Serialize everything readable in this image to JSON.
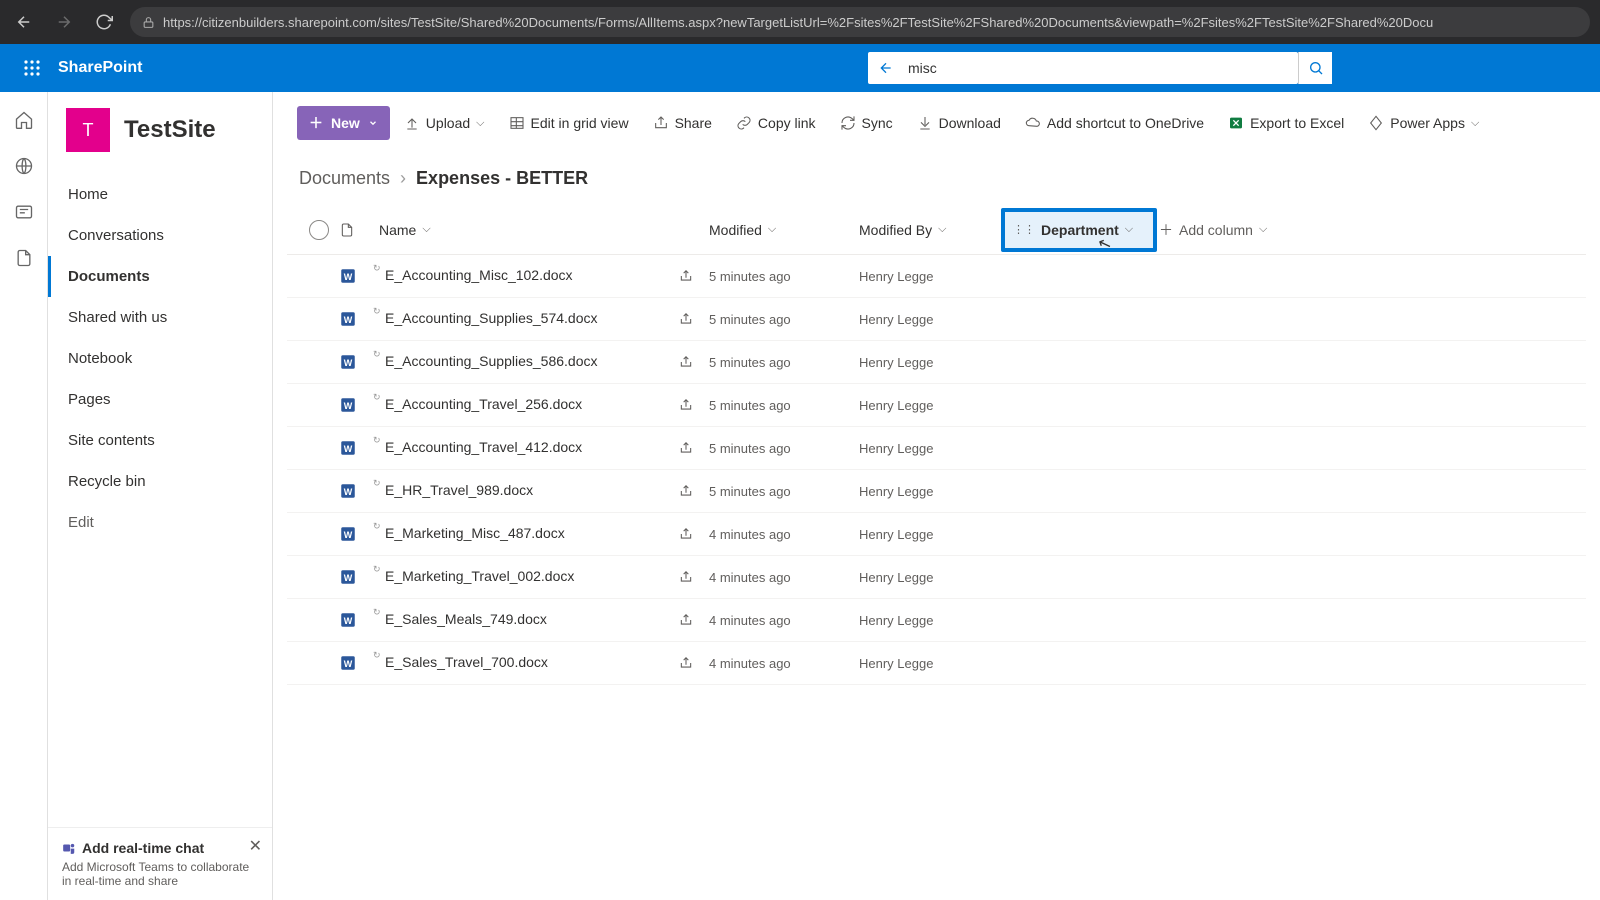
{
  "browser": {
    "url": "https://citizenbuilders.sharepoint.com/sites/TestSite/Shared%20Documents/Forms/AllItems.aspx?newTargetListUrl=%2Fsites%2FTestSite%2FShared%20Documents&viewpath=%2Fsites%2FTestSite%2FShared%20Docu"
  },
  "header": {
    "brand": "SharePoint",
    "search_value": "misc"
  },
  "site": {
    "logo_letter": "T",
    "title": "TestSite"
  },
  "nav": {
    "items": [
      "Home",
      "Conversations",
      "Documents",
      "Shared with us",
      "Notebook",
      "Pages",
      "Site contents",
      "Recycle bin"
    ],
    "edit": "Edit",
    "active_index": 2
  },
  "teams": {
    "title": "Add real-time chat",
    "body": "Add Microsoft Teams to collaborate in real-time and share"
  },
  "cmdbar": {
    "new": "New",
    "upload": "Upload",
    "edit_grid": "Edit in grid view",
    "share": "Share",
    "copy_link": "Copy link",
    "sync": "Sync",
    "download": "Download",
    "add_shortcut": "Add shortcut to OneDrive",
    "export": "Export to Excel",
    "power_apps": "Power Apps"
  },
  "breadcrumb": {
    "root": "Documents",
    "current": "Expenses - BETTER"
  },
  "columns": {
    "name": "Name",
    "modified": "Modified",
    "modified_by": "Modified By",
    "department": "Department",
    "add": "Add column"
  },
  "rows": [
    {
      "name": "E_Accounting_Misc_102.docx",
      "modified": "5 minutes ago",
      "by": "Henry Legge"
    },
    {
      "name": "E_Accounting_Supplies_574.docx",
      "modified": "5 minutes ago",
      "by": "Henry Legge"
    },
    {
      "name": "E_Accounting_Supplies_586.docx",
      "modified": "5 minutes ago",
      "by": "Henry Legge"
    },
    {
      "name": "E_Accounting_Travel_256.docx",
      "modified": "5 minutes ago",
      "by": "Henry Legge"
    },
    {
      "name": "E_Accounting_Travel_412.docx",
      "modified": "5 minutes ago",
      "by": "Henry Legge"
    },
    {
      "name": "E_HR_Travel_989.docx",
      "modified": "5 minutes ago",
      "by": "Henry Legge"
    },
    {
      "name": "E_Marketing_Misc_487.docx",
      "modified": "4 minutes ago",
      "by": "Henry Legge"
    },
    {
      "name": "E_Marketing_Travel_002.docx",
      "modified": "4 minutes ago",
      "by": "Henry Legge"
    },
    {
      "name": "E_Sales_Meals_749.docx",
      "modified": "4 minutes ago",
      "by": "Henry Legge"
    },
    {
      "name": "E_Sales_Travel_700.docx",
      "modified": "4 minutes ago",
      "by": "Henry Legge"
    }
  ]
}
